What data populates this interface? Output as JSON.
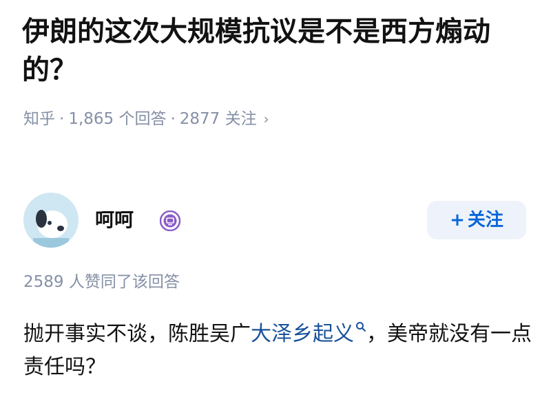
{
  "question": {
    "title": "伊朗的这次大规模抗议是不是西方煽动的？"
  },
  "meta": {
    "source": "知乎",
    "separator": "·",
    "answers": "1,865 个回答",
    "followers": "2877 关注",
    "chevron": "›"
  },
  "author": {
    "name": "呵呵",
    "follow_plus": "+",
    "follow_label": "关注"
  },
  "answer": {
    "likes_text": "2589 人赞同了该回答",
    "text_before_link": "抛开事实不谈，陈胜吴广",
    "link_text": "大泽乡起义",
    "text_after_link": "，美帝就没有一点责任吗？"
  },
  "colors": {
    "accent": "#0a66d8",
    "link": "#175199",
    "muted": "#8590a6",
    "badge": "#8a5cc7"
  },
  "icons": {
    "avatar": "dog-avatar",
    "badge": "verified-badge-icon",
    "search": "search-icon"
  }
}
